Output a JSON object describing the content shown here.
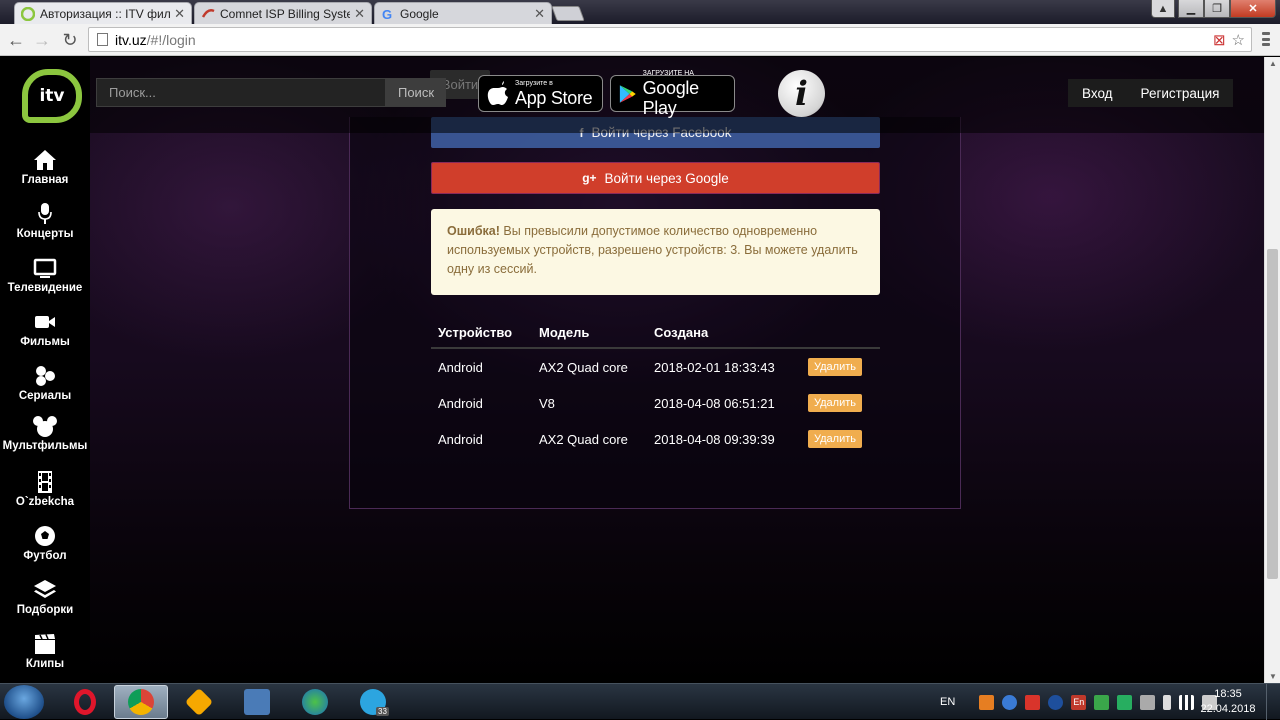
{
  "browser": {
    "tabs": [
      {
        "title": "Авторизация :: ITV фильмы",
        "active": true
      },
      {
        "title": "Comnet ISP Billing System",
        "active": false
      },
      {
        "title": "Google",
        "active": false
      }
    ],
    "url_host": "itv.uz",
    "url_path": "/#!/login"
  },
  "sidebar": {
    "logo_text": "itv",
    "items": [
      {
        "label": "Главная",
        "icon": "home-icon"
      },
      {
        "label": "Концерты",
        "icon": "microphone-icon"
      },
      {
        "label": "Телевидение",
        "icon": "tv-icon"
      },
      {
        "label": "Фильмы",
        "icon": "video-camera-icon"
      },
      {
        "label": "Сериалы",
        "icon": "series-icon"
      },
      {
        "label": "Мультфильмы",
        "icon": "mickey-icon"
      },
      {
        "label": "O`zbekcha",
        "icon": "film-strip-icon"
      },
      {
        "label": "Футбол",
        "icon": "football-icon"
      },
      {
        "label": "Подборки",
        "icon": "layers-icon"
      },
      {
        "label": "Клипы",
        "icon": "clapper-icon"
      }
    ]
  },
  "header": {
    "search_placeholder": "Поиск...",
    "search_button": "Поиск",
    "login_hidden": "Войти",
    "appstore_small": "Загрузите в",
    "appstore_big": "App Store",
    "googleplay_small": "ЗАГРУЗИТЕ НА",
    "googleplay_big": "Google Play",
    "login": "Вход",
    "register": "Регистрация"
  },
  "login": {
    "facebook_button": "Войти через Facebook",
    "google_button": "Войти через Google",
    "alert_strong": "Ошибка!",
    "alert_text": " Вы превысили допустимое количество одновременно используемых устройств, разрешено устройств: 3. Вы можете удалить одну из сессий."
  },
  "sessions": {
    "headers": [
      "Устройство",
      "Модель",
      "Создана"
    ],
    "rows": [
      {
        "device": "Android",
        "model": "AX2 Quad core",
        "created": "2018-02-01 18:33:43",
        "action": "Удалить"
      },
      {
        "device": "Android",
        "model": "V8",
        "created": "2018-04-08 06:51:21",
        "action": "Удалить"
      },
      {
        "device": "Android",
        "model": "AX2 Quad core",
        "created": "2018-04-08 09:39:39",
        "action": "Удалить"
      }
    ]
  },
  "taskbar": {
    "language": "EN",
    "telegram_badge": "33",
    "tray_lang": "En",
    "time": "18:35",
    "date": "22.04.2018"
  },
  "colors": {
    "accent_green": "#8cc63f",
    "google_red": "#d03e2b",
    "facebook_blue": "#3b5998",
    "delete_orange": "#f0ad4e"
  }
}
